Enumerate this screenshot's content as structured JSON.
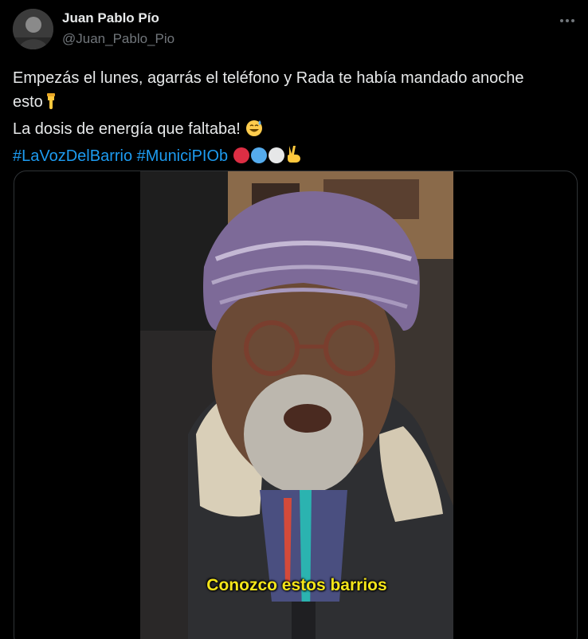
{
  "author": {
    "display_name": "Juan Pablo Pío",
    "handle": "@Juan_Pablo_Pio",
    "avatar_icon": "avatar-photo"
  },
  "actions": {
    "more_icon": "more-horizontal-icon"
  },
  "tweet": {
    "line1": "Empezás el lunes, agarrás el teléfono y Rada te había mandado anoche",
    "line2": "esto",
    "line3": "La dosis de energía que faltaba!",
    "hashtags": [
      "#LaVozDelBarrio",
      "#MuniciPIOb"
    ],
    "emojis": [
      "backhand-index-pointing-down",
      "grinning-face-with-sweat",
      "red-circle",
      "blue-circle",
      "white-circle",
      "victory-hand"
    ]
  },
  "media": {
    "type": "video",
    "subtitle": "Conozco estos barrios"
  },
  "colors": {
    "background": "#000000",
    "text": "#e7e9ea",
    "secondary_text": "#71767b",
    "link": "#1d9bf0",
    "border": "#2f3336",
    "subtitle": "#f4e51a"
  }
}
